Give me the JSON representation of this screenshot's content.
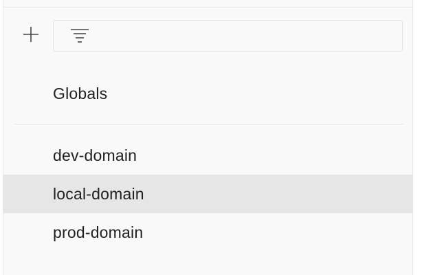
{
  "toolbar": {
    "add_icon": "plus-icon",
    "filter_icon": "filter-icon",
    "filter_value": "",
    "filter_placeholder": ""
  },
  "globals": {
    "label": "Globals"
  },
  "environments": [
    {
      "label": "dev-domain",
      "selected": false
    },
    {
      "label": "local-domain",
      "selected": true
    },
    {
      "label": "prod-domain",
      "selected": false
    }
  ],
  "colors": {
    "panel_bg": "#f9f9f9",
    "selected_bg": "#e6e6e6",
    "text": "#212121",
    "border": "#e6e6e6"
  }
}
